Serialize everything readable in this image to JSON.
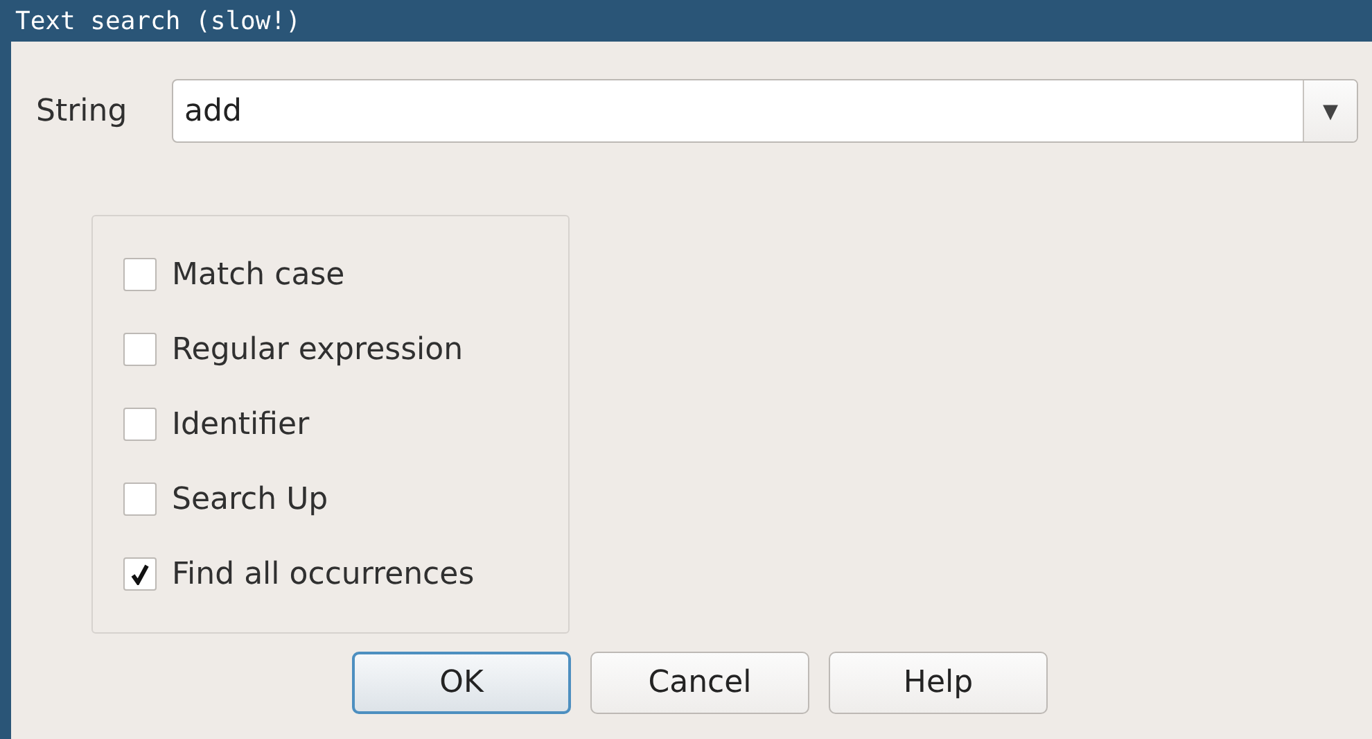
{
  "window": {
    "title": "Text search (slow!)"
  },
  "string_field": {
    "label": "String",
    "value": "add",
    "dropdown_arrow": "▾"
  },
  "options": [
    {
      "label": "Match case",
      "checked": false
    },
    {
      "label": "Regular expression",
      "checked": false
    },
    {
      "label": "Identifier",
      "checked": false
    },
    {
      "label": "Search Up",
      "checked": false
    },
    {
      "label": "Find all occurrences",
      "checked": true
    }
  ],
  "buttons": [
    {
      "label": "OK",
      "default": true
    },
    {
      "label": "Cancel",
      "default": false
    },
    {
      "label": "Help",
      "default": false
    }
  ]
}
